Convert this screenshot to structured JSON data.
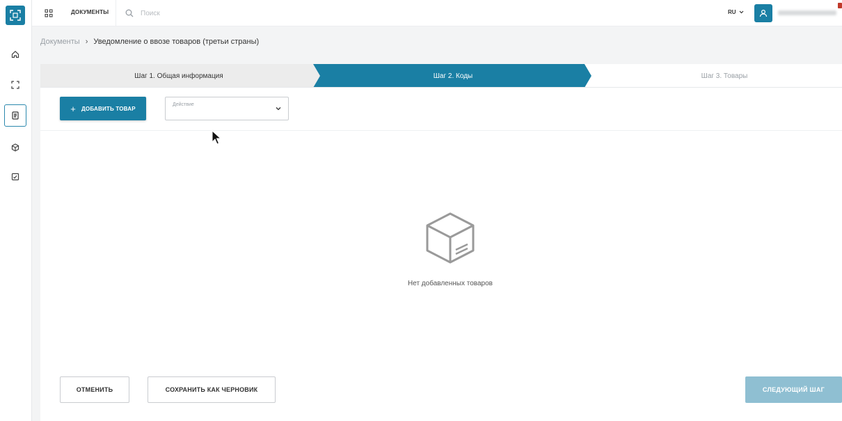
{
  "app": {
    "logo_icon": "qr-scan-icon",
    "accent_color": "#1a7fa4"
  },
  "rail": {
    "items": [
      {
        "icon": "home-icon"
      },
      {
        "icon": "scan-frame-icon"
      },
      {
        "icon": "document-icon",
        "active": true
      },
      {
        "icon": "cube-icon"
      },
      {
        "icon": "checklist-icon"
      }
    ]
  },
  "topbar": {
    "apps_icon": "apps-grid-icon",
    "section_label": "ДОКУМЕНТЫ",
    "search_placeholder": "Поиск",
    "lang": "RU",
    "user_icon": "user-icon"
  },
  "breadcrumb": {
    "root": "Документы",
    "current": "Уведомление о ввозе товаров (третьи страны)"
  },
  "steps": [
    {
      "label": "Шаг 1. Общая информация",
      "state": "done"
    },
    {
      "label": "Шаг 2. Коды",
      "state": "active"
    },
    {
      "label": "Шаг 3. Товары",
      "state": "pending"
    }
  ],
  "toolbar": {
    "add_label": "ДОБАВИТЬ ТОВАР",
    "action_label": "Действие"
  },
  "empty": {
    "icon": "box-icon",
    "text": "Нет добавленных товаров"
  },
  "footer": {
    "cancel_label": "ОТМЕНИТЬ",
    "save_draft_label": "СОХРАНИТЬ КАК ЧЕРНОВИК",
    "next_label": "СЛЕДУЮЩИЙ ШАГ"
  },
  "colors": {
    "step_done_bg": "#ececec",
    "step_active_bg": "#1a7fa4",
    "step_pending_bg": "#ffffff",
    "next_disabled_bg": "#8fbfd2"
  }
}
